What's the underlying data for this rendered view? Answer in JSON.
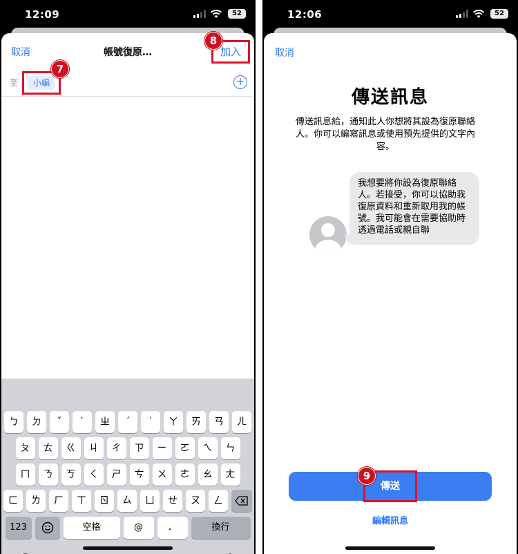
{
  "left": {
    "status": {
      "time": "12:09",
      "battery": "52"
    },
    "nav": {
      "cancel": "取消",
      "title": "帳號復原…",
      "add": "加入"
    },
    "to_row": {
      "label": "至",
      "recipient": "小編",
      "plus": "+"
    },
    "steps": {
      "add": "8",
      "recipient": "7"
    },
    "keyboard": {
      "row1": [
        "ㄅ",
        "ㄉ",
        "ˇ",
        "ˋ",
        "ㄓ",
        "ˊ",
        "˙",
        "ㄚ",
        "ㄞ",
        "ㄢ",
        "ㄦ"
      ],
      "row2": [
        "ㄆ",
        "ㄊ",
        "ㄍ",
        "ㄐ",
        "ㄔ",
        "ㄗ",
        "ㄧ",
        "ㄛ",
        "ㄟ",
        "ㄣ"
      ],
      "row3": [
        "ㄇ",
        "ㄋ",
        "ㄎ",
        "ㄑ",
        "ㄕ",
        "ㄘ",
        "ㄨ",
        "ㄜ",
        "ㄠ",
        "ㄤ"
      ],
      "row4": [
        "ㄈ",
        "ㄌ",
        "ㄏ",
        "ㄒ",
        "ㄖ",
        "ㄙ",
        "ㄩ",
        "ㄝ",
        "ㄡ",
        "ㄥ"
      ],
      "numbers": "123",
      "space": "空格",
      "at": "@",
      "dot": "．",
      "return": "換行",
      "icons": [
        "globe-icon",
        "microphone-icon",
        "emoji-icon",
        "backspace-icon"
      ]
    }
  },
  "right": {
    "status": {
      "time": "12:06",
      "battery": "52"
    },
    "cancel": "取消",
    "title": "傳送訊息",
    "description": "傳送訊息給，通知此人你想將其設為復原聯絡人。你可以編寫訊息或使用預先提供的文字內容。",
    "message": "我想要將你設為復原聯絡人。若接受，你可以協助我復原資料和重新取用我的帳號。我可能會在需要協助時透過電話或親自聯",
    "send": "傳送",
    "edit": "編輯訊息",
    "step": "9"
  },
  "colors": {
    "accent": "#3478f6",
    "highlight": "#e0102a",
    "send_button": "#3a7ef2"
  }
}
